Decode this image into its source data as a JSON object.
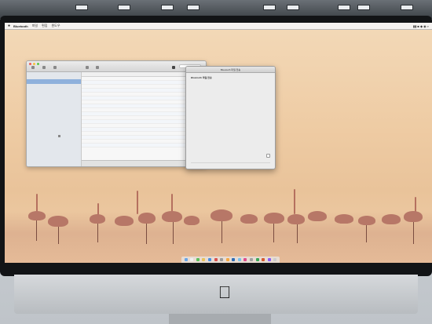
{
  "menubar": {
    "apple": "",
    "app_name": "Bluetooth",
    "menu_items": [
      "파일",
      "편집",
      "윈도우"
    ],
    "status_right": "▮▮ ■ ◆ ◉ ⌕"
  },
  "main_window": {
    "title": "",
    "sidebar_rows": [
      "",
      "",
      ""
    ],
    "sidebar_head": "",
    "list_headers": [
      "",
      "",
      "",
      "",
      ""
    ],
    "status_text": ""
  },
  "dialog": {
    "title": "Bluetooth 파일 전송",
    "heading": "Bluetooth 파일 전송",
    "paragraphs": [
      "",
      ""
    ],
    "footer": ""
  },
  "dock": {
    "colors": [
      "#6aa6e8",
      "#f0f0f0",
      "#5cbf5c",
      "#e8c15a",
      "#4b8fe0",
      "#d9534f",
      "#9a9a9a",
      "#f5a742",
      "#2f6db5",
      "#7cc0ea",
      "#e04c8b",
      "#a0a0a0",
      "#3aa757",
      "#d65a31",
      "#8b5cf6",
      "#cccccc"
    ]
  },
  "colors": {
    "wallpaper_top": "#f3d9b8",
    "wallpaper_bottom": "#f0cfa9",
    "selection": "#8fb1dc",
    "flamingo": "#b77767"
  }
}
